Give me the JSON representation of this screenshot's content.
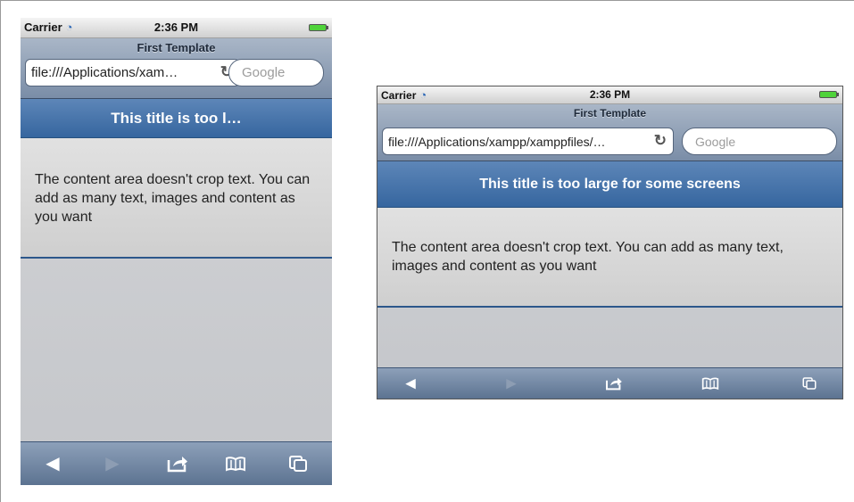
{
  "status": {
    "carrier": "Carrier",
    "time": "2:36 PM"
  },
  "safari": {
    "page_title": "First Template",
    "url_portrait": "file:///Applications/xam…",
    "url_landscape": "file:///Applications/xampp/xamppfiles/…",
    "search_placeholder": "Google"
  },
  "header": {
    "title_portrait": "This title is too l…",
    "title_landscape": "This title is too large for some screens"
  },
  "content": {
    "text": "The content area doesn't crop text. You can add as many text, images and content as you want"
  },
  "toolbar": {
    "icons": [
      "back-icon",
      "forward-icon",
      "share-icon",
      "bookmarks-icon",
      "pages-icon"
    ]
  },
  "colors": {
    "header_blue": "#36669f",
    "safari_bar": "#7a8da7",
    "battery_green": "#4fd33a"
  }
}
